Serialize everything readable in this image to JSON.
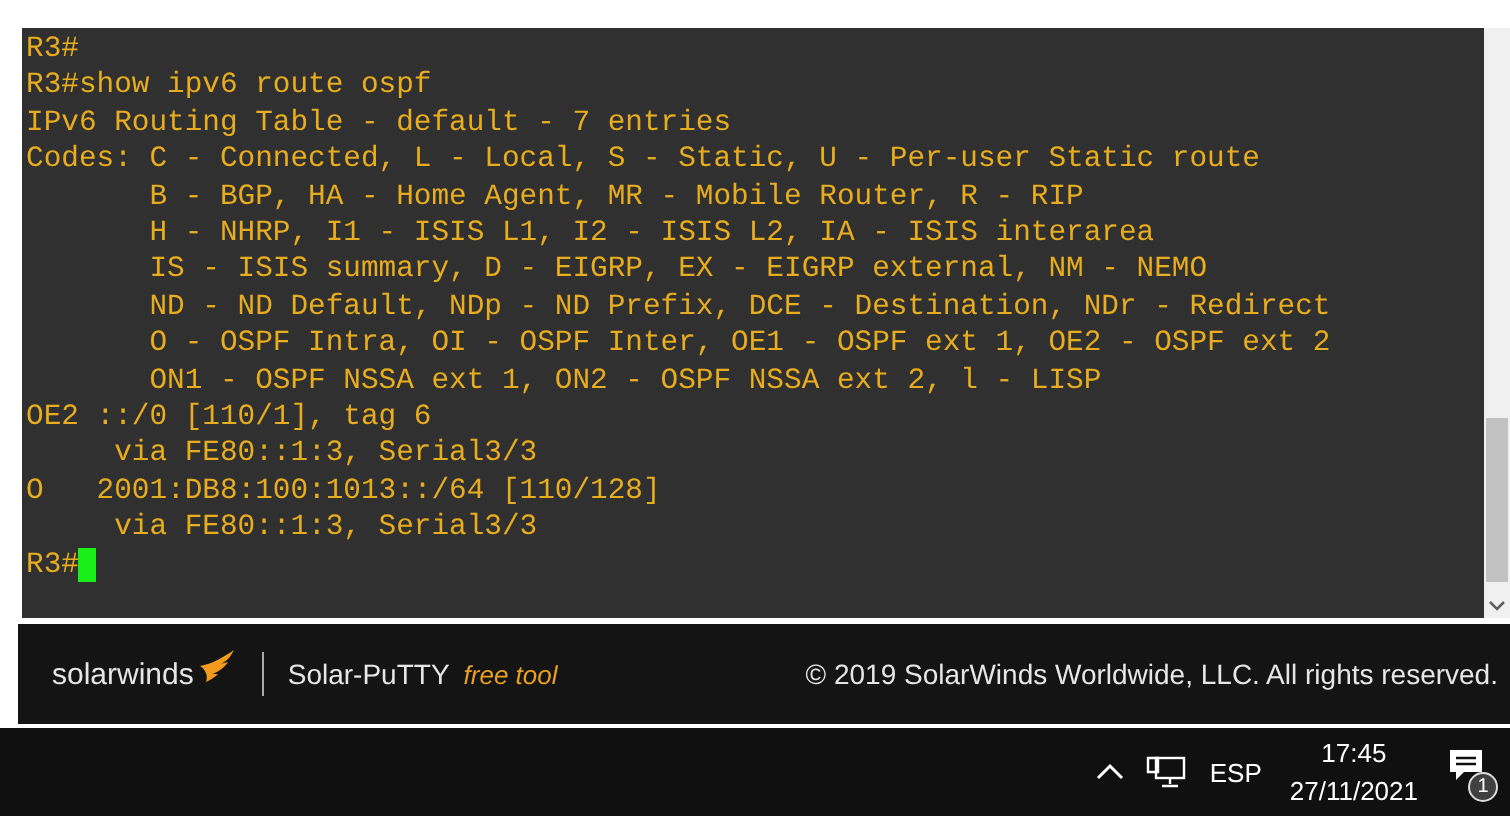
{
  "terminal": {
    "lines": [
      "R3#",
      "R3#show ipv6 route ospf",
      "IPv6 Routing Table - default - 7 entries",
      "Codes: C - Connected, L - Local, S - Static, U - Per-user Static route",
      "       B - BGP, HA - Home Agent, MR - Mobile Router, R - RIP",
      "       H - NHRP, I1 - ISIS L1, I2 - ISIS L2, IA - ISIS interarea",
      "       IS - ISIS summary, D - EIGRP, EX - EIGRP external, NM - NEMO",
      "       ND - ND Default, NDp - ND Prefix, DCE - Destination, NDr - Redirect",
      "       O - OSPF Intra, OI - OSPF Inter, OE1 - OSPF ext 1, OE2 - OSPF ext 2",
      "       ON1 - OSPF NSSA ext 1, ON2 - OSPF NSSA ext 2, l - LISP",
      "OE2 ::/0 [110/1], tag 6",
      "     via FE80::1:3, Serial3/3",
      "O   2001:DB8:100:1013::/64 [110/128]",
      "     via FE80::1:3, Serial3/3"
    ],
    "prompt": "R3#"
  },
  "footer": {
    "brand": "solarwinds",
    "product": "Solar-PuTTY",
    "tag": "free tool",
    "copyright": "© 2019 SolarWinds Worldwide, LLC. All rights reserved."
  },
  "taskbar": {
    "language": "ESP",
    "time": "17:45",
    "date": "27/11/2021",
    "notifications": "1"
  }
}
